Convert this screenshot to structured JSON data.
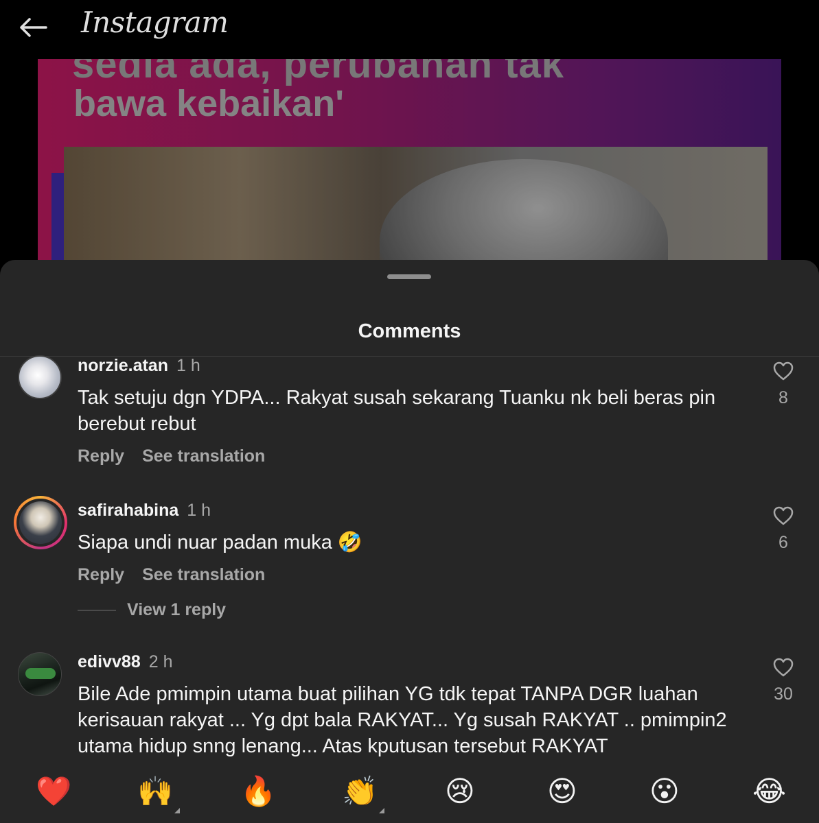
{
  "app": {
    "title": "Instagram"
  },
  "post": {
    "headline_top": "sedia ada, perubahan tak",
    "headline": "bawa kebaikan'"
  },
  "sheet": {
    "title": "Comments"
  },
  "comments": [
    {
      "username": "norzie.atan",
      "time": "1 h",
      "text": "Tak setuju dgn YDPA... Rakyat susah sekarang Tuanku nk beli beras pin berebut rebut",
      "reply_label": "Reply",
      "translate_label": "See translation",
      "likes": "8"
    },
    {
      "username": "safirahabina",
      "time": "1 h",
      "text": "Siapa undi nuar padan muka 🤣",
      "reply_label": "Reply",
      "translate_label": "See translation",
      "likes": "6",
      "view_replies": "View 1 reply"
    },
    {
      "username": "edivv88",
      "time": "2 h",
      "text": "Bile Ade pmimpin utama buat pilihan YG tdk tepat TANPA DGR luahan kerisauan rakyat ... Yg dpt bala RAKYAT... Yg susah RAKYAT .. pmimpin2 utama hidup snng lenang... Atas kputusan tersebut RAKYAT",
      "likes": "30"
    }
  ],
  "reactions": [
    "❤️",
    "🙌",
    "🔥",
    "👏",
    "😢",
    "😍",
    "😮",
    "😂"
  ],
  "icons": {
    "back": "back-arrow-icon",
    "like": "heart-outline-icon"
  },
  "colors": {
    "sheet_bg": "#262626",
    "secondary_text": "#a8a8a8",
    "primary_text": "#f5f5f5"
  }
}
